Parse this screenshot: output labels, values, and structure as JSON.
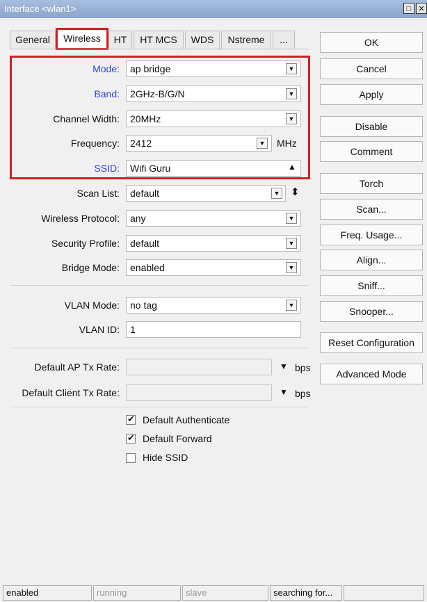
{
  "window": {
    "title": "Interface <wlan1>"
  },
  "tabs": [
    {
      "label": "General"
    },
    {
      "label": "Wireless"
    },
    {
      "label": "HT"
    },
    {
      "label": "HT MCS"
    },
    {
      "label": "WDS"
    },
    {
      "label": "Nstreme"
    },
    {
      "label": "..."
    }
  ],
  "active_tab": "Wireless",
  "form": {
    "mode": {
      "label": "Mode:",
      "value": "ap bridge"
    },
    "band": {
      "label": "Band:",
      "value": "2GHz-B/G/N"
    },
    "channel_width": {
      "label": "Channel Width:",
      "value": "20MHz"
    },
    "frequency": {
      "label": "Frequency:",
      "value": "2412",
      "unit": "MHz"
    },
    "ssid": {
      "label": "SSID:",
      "value": "Wifi Guru"
    },
    "scan_list": {
      "label": "Scan List:",
      "value": "default"
    },
    "wireless_protocol": {
      "label": "Wireless Protocol:",
      "value": "any"
    },
    "security_profile": {
      "label": "Security Profile:",
      "value": "default"
    },
    "bridge_mode": {
      "label": "Bridge Mode:",
      "value": "enabled"
    },
    "vlan_mode": {
      "label": "VLAN Mode:",
      "value": "no tag"
    },
    "vlan_id": {
      "label": "VLAN ID:",
      "value": "1"
    },
    "default_ap_tx_rate": {
      "label": "Default AP Tx Rate:",
      "value": "",
      "unit": "bps"
    },
    "default_client_tx_rate": {
      "label": "Default Client Tx Rate:",
      "value": "",
      "unit": "bps"
    }
  },
  "checkboxes": [
    {
      "label": "Default Authenticate",
      "checked": true
    },
    {
      "label": "Default Forward",
      "checked": true
    },
    {
      "label": "Hide SSID",
      "checked": false
    }
  ],
  "buttons": {
    "ok": "OK",
    "cancel": "Cancel",
    "apply": "Apply",
    "disable": "Disable",
    "comment": "Comment",
    "torch": "Torch",
    "scan": "Scan...",
    "freq_usage": "Freq. Usage...",
    "align": "Align...",
    "sniff": "Sniff...",
    "snooper": "Snooper...",
    "reset_configuration": "Reset Configuration",
    "advanced_mode": "Advanced Mode"
  },
  "status": [
    "enabled",
    "running",
    "slave",
    "searching for..."
  ],
  "colors": {
    "highlight": "#d31f26",
    "label_blue": "#2a43d6",
    "title_bar": "#8aa5cc"
  },
  "icons": {
    "dropdown": "dropdown-arrow-icon",
    "updown": "up-down-icon",
    "collapse": "triangle-up-icon",
    "check": "checkmark-icon"
  }
}
